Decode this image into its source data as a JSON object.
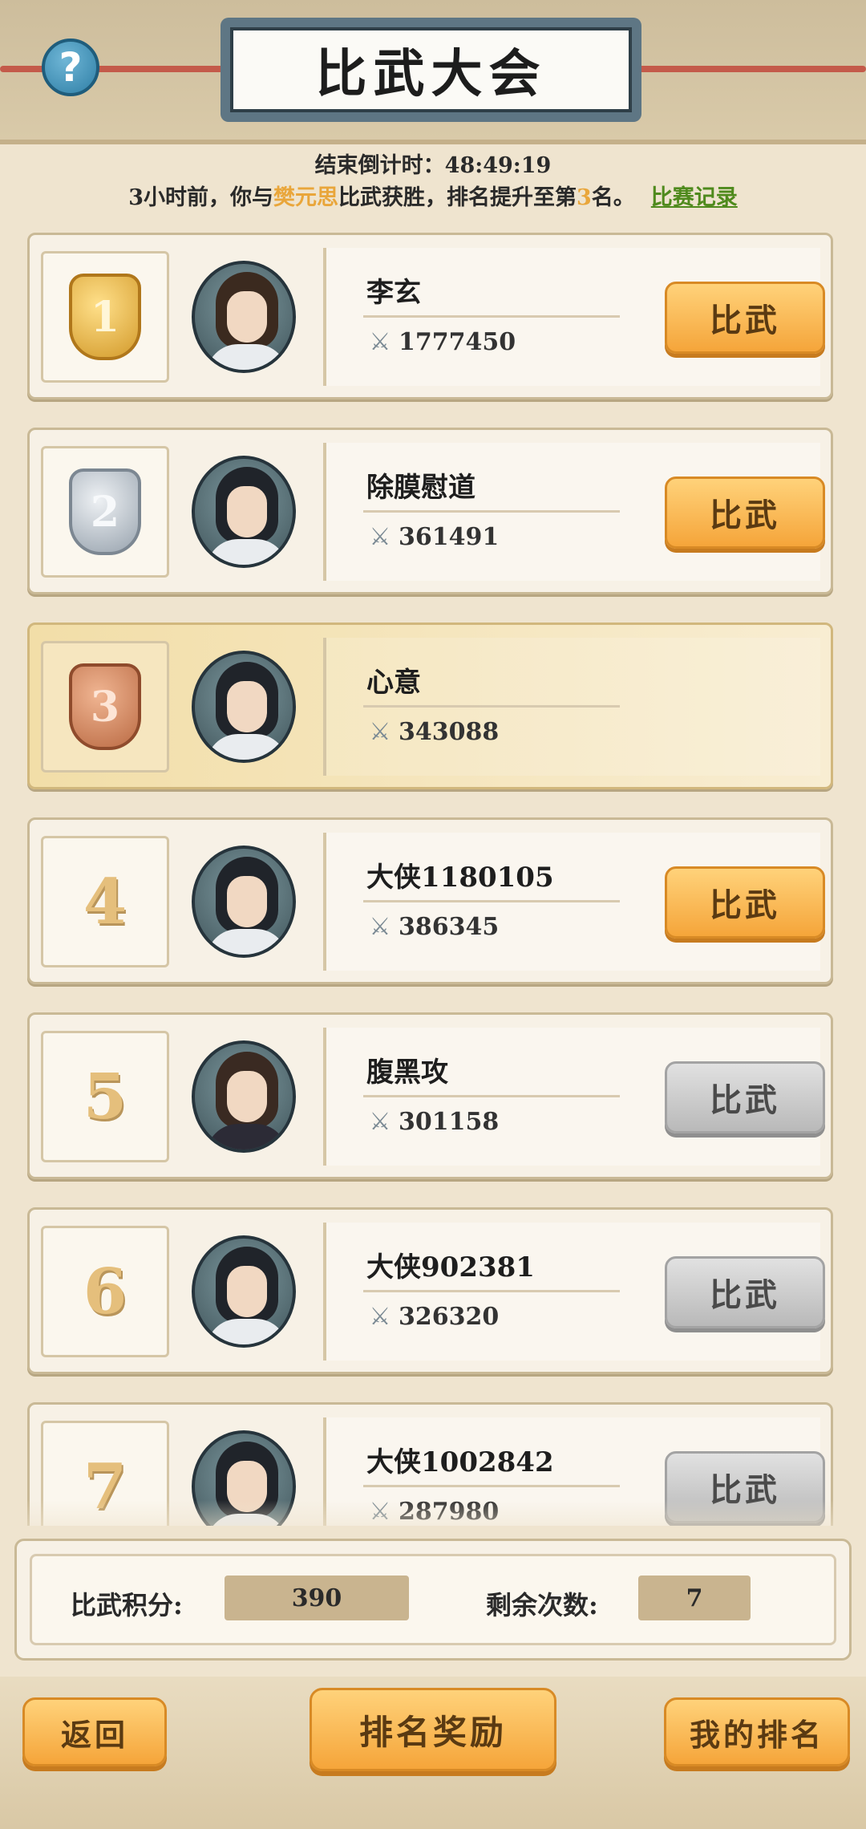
{
  "header": {
    "title": "比武大会",
    "help_icon": "?"
  },
  "countdown": {
    "label": "结束倒计时：",
    "value": "48:49:19"
  },
  "record_line": {
    "prefix": "3小时前，你与",
    "opponent": "樊元思",
    "middle": "比武获胜，排名提升至第",
    "rank": "3",
    "suffix": "名。",
    "link_label": "比赛记录"
  },
  "rankings": [
    {
      "rank": "1",
      "badge": "gold",
      "name": "李玄",
      "power": "1777450",
      "button": "比武",
      "enabled": true
    },
    {
      "rank": "2",
      "badge": "silver",
      "name": "除膜慰道",
      "power": "361491",
      "button": "比武",
      "enabled": true
    },
    {
      "rank": "3",
      "badge": "bronze",
      "name": "心意",
      "power": "343088",
      "button": "",
      "enabled": false,
      "is_self": true
    },
    {
      "rank": "4",
      "badge": "",
      "name": "大侠1180105",
      "power": "386345",
      "button": "比武",
      "enabled": true
    },
    {
      "rank": "5",
      "badge": "",
      "name": "腹黑攻",
      "power": "301158",
      "button": "比武",
      "enabled": false
    },
    {
      "rank": "6",
      "badge": "",
      "name": "大侠902381",
      "power": "326320",
      "button": "比武",
      "enabled": false
    },
    {
      "rank": "7",
      "badge": "",
      "name": "大侠1002842",
      "power": "287980",
      "button": "比武",
      "enabled": false
    }
  ],
  "stats": {
    "points_label": "比武积分:",
    "points_value": "390",
    "remaining_label": "剩余次数:",
    "remaining_value": "7"
  },
  "bottom_buttons": {
    "back": "返回",
    "rewards": "排名奖励",
    "my_rank": "我的排名"
  },
  "colors": {
    "accent": "#f5a53a",
    "highlight_text": "#e9a63b",
    "link": "#4f8a1d"
  }
}
